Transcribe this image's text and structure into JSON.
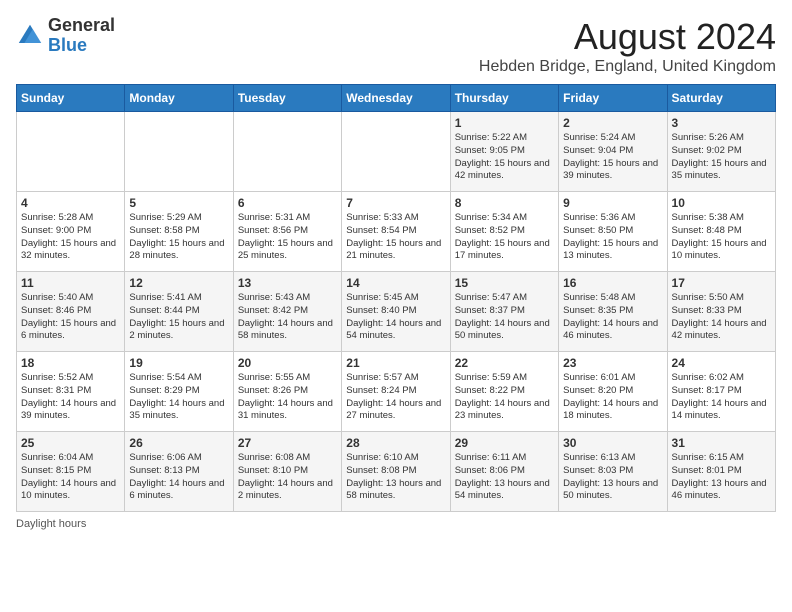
{
  "header": {
    "logo_general": "General",
    "logo_blue": "Blue",
    "month_year": "August 2024",
    "location": "Hebden Bridge, England, United Kingdom"
  },
  "calendar": {
    "days_of_week": [
      "Sunday",
      "Monday",
      "Tuesday",
      "Wednesday",
      "Thursday",
      "Friday",
      "Saturday"
    ],
    "rows": [
      [
        {
          "day": "",
          "content": ""
        },
        {
          "day": "",
          "content": ""
        },
        {
          "day": "",
          "content": ""
        },
        {
          "day": "",
          "content": ""
        },
        {
          "day": "1",
          "content": "Sunrise: 5:22 AM\nSunset: 9:05 PM\nDaylight: 15 hours and 42 minutes."
        },
        {
          "day": "2",
          "content": "Sunrise: 5:24 AM\nSunset: 9:04 PM\nDaylight: 15 hours and 39 minutes."
        },
        {
          "day": "3",
          "content": "Sunrise: 5:26 AM\nSunset: 9:02 PM\nDaylight: 15 hours and 35 minutes."
        }
      ],
      [
        {
          "day": "4",
          "content": "Sunrise: 5:28 AM\nSunset: 9:00 PM\nDaylight: 15 hours and 32 minutes."
        },
        {
          "day": "5",
          "content": "Sunrise: 5:29 AM\nSunset: 8:58 PM\nDaylight: 15 hours and 28 minutes."
        },
        {
          "day": "6",
          "content": "Sunrise: 5:31 AM\nSunset: 8:56 PM\nDaylight: 15 hours and 25 minutes."
        },
        {
          "day": "7",
          "content": "Sunrise: 5:33 AM\nSunset: 8:54 PM\nDaylight: 15 hours and 21 minutes."
        },
        {
          "day": "8",
          "content": "Sunrise: 5:34 AM\nSunset: 8:52 PM\nDaylight: 15 hours and 17 minutes."
        },
        {
          "day": "9",
          "content": "Sunrise: 5:36 AM\nSunset: 8:50 PM\nDaylight: 15 hours and 13 minutes."
        },
        {
          "day": "10",
          "content": "Sunrise: 5:38 AM\nSunset: 8:48 PM\nDaylight: 15 hours and 10 minutes."
        }
      ],
      [
        {
          "day": "11",
          "content": "Sunrise: 5:40 AM\nSunset: 8:46 PM\nDaylight: 15 hours and 6 minutes."
        },
        {
          "day": "12",
          "content": "Sunrise: 5:41 AM\nSunset: 8:44 PM\nDaylight: 15 hours and 2 minutes."
        },
        {
          "day": "13",
          "content": "Sunrise: 5:43 AM\nSunset: 8:42 PM\nDaylight: 14 hours and 58 minutes."
        },
        {
          "day": "14",
          "content": "Sunrise: 5:45 AM\nSunset: 8:40 PM\nDaylight: 14 hours and 54 minutes."
        },
        {
          "day": "15",
          "content": "Sunrise: 5:47 AM\nSunset: 8:37 PM\nDaylight: 14 hours and 50 minutes."
        },
        {
          "day": "16",
          "content": "Sunrise: 5:48 AM\nSunset: 8:35 PM\nDaylight: 14 hours and 46 minutes."
        },
        {
          "day": "17",
          "content": "Sunrise: 5:50 AM\nSunset: 8:33 PM\nDaylight: 14 hours and 42 minutes."
        }
      ],
      [
        {
          "day": "18",
          "content": "Sunrise: 5:52 AM\nSunset: 8:31 PM\nDaylight: 14 hours and 39 minutes."
        },
        {
          "day": "19",
          "content": "Sunrise: 5:54 AM\nSunset: 8:29 PM\nDaylight: 14 hours and 35 minutes."
        },
        {
          "day": "20",
          "content": "Sunrise: 5:55 AM\nSunset: 8:26 PM\nDaylight: 14 hours and 31 minutes."
        },
        {
          "day": "21",
          "content": "Sunrise: 5:57 AM\nSunset: 8:24 PM\nDaylight: 14 hours and 27 minutes."
        },
        {
          "day": "22",
          "content": "Sunrise: 5:59 AM\nSunset: 8:22 PM\nDaylight: 14 hours and 23 minutes."
        },
        {
          "day": "23",
          "content": "Sunrise: 6:01 AM\nSunset: 8:20 PM\nDaylight: 14 hours and 18 minutes."
        },
        {
          "day": "24",
          "content": "Sunrise: 6:02 AM\nSunset: 8:17 PM\nDaylight: 14 hours and 14 minutes."
        }
      ],
      [
        {
          "day": "25",
          "content": "Sunrise: 6:04 AM\nSunset: 8:15 PM\nDaylight: 14 hours and 10 minutes."
        },
        {
          "day": "26",
          "content": "Sunrise: 6:06 AM\nSunset: 8:13 PM\nDaylight: 14 hours and 6 minutes."
        },
        {
          "day": "27",
          "content": "Sunrise: 6:08 AM\nSunset: 8:10 PM\nDaylight: 14 hours and 2 minutes."
        },
        {
          "day": "28",
          "content": "Sunrise: 6:10 AM\nSunset: 8:08 PM\nDaylight: 13 hours and 58 minutes."
        },
        {
          "day": "29",
          "content": "Sunrise: 6:11 AM\nSunset: 8:06 PM\nDaylight: 13 hours and 54 minutes."
        },
        {
          "day": "30",
          "content": "Sunrise: 6:13 AM\nSunset: 8:03 PM\nDaylight: 13 hours and 50 minutes."
        },
        {
          "day": "31",
          "content": "Sunrise: 6:15 AM\nSunset: 8:01 PM\nDaylight: 13 hours and 46 minutes."
        }
      ]
    ]
  },
  "footer": {
    "note": "Daylight hours"
  }
}
